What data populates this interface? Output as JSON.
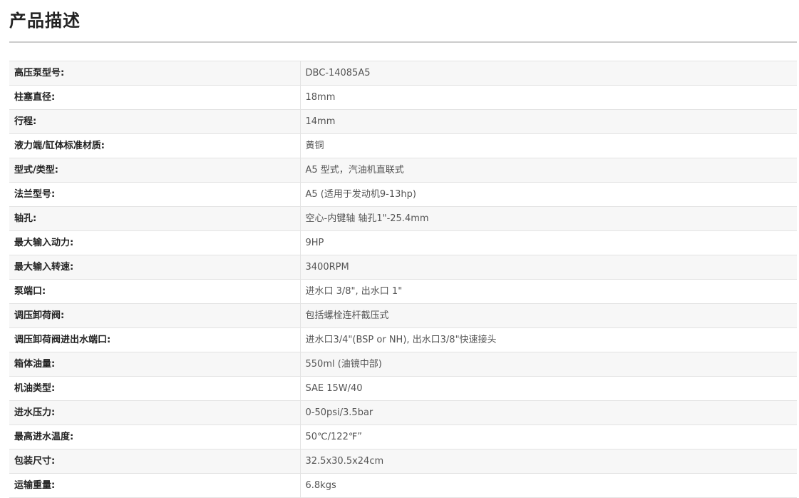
{
  "page": {
    "title": "产品描述"
  },
  "specs": [
    {
      "label": "高压泵型号:",
      "value": "DBC-14085A5"
    },
    {
      "label": "柱塞直径:",
      "value": "18mm"
    },
    {
      "label": "行程:",
      "value": "14mm"
    },
    {
      "label": "液力端/缸体标准材质:",
      "value": "黄铜"
    },
    {
      "label": "型式/类型:",
      "value": "A5 型式，汽油机直联式"
    },
    {
      "label": "法兰型号:",
      "value": "A5 (适用于发动机9-13hp)"
    },
    {
      "label": "轴孔:",
      "value": "空心-内键轴  轴孔1\"-25.4mm"
    },
    {
      "label": "最大输入动力:",
      "value": "9HP"
    },
    {
      "label": "最大输入转速:",
      "value": "3400RPM"
    },
    {
      "label": "泵端口:",
      "value": "进水口 3/8\", 出水口 1\""
    },
    {
      "label": "调压卸荷阀:",
      "value": "包括螺栓连杆截压式"
    },
    {
      "label": "调压卸荷阀进出水端口:",
      "value": "进水口3/4\"(BSP or NH), 出水口3/8\"快速接头"
    },
    {
      "label": "箱体油量:",
      "value": "550ml (油镜中部)"
    },
    {
      "label": "机油类型:",
      "value": "SAE 15W/40"
    },
    {
      "label": "进水压力:",
      "value": "0-50psi/3.5bar"
    },
    {
      "label": "最高进水温度:",
      "value": "50℃/122℉”"
    },
    {
      "label": "包装尺寸:",
      "value": "32.5x30.5x24cm"
    },
    {
      "label": "运输重量:",
      "value": "6.8kgs"
    }
  ]
}
